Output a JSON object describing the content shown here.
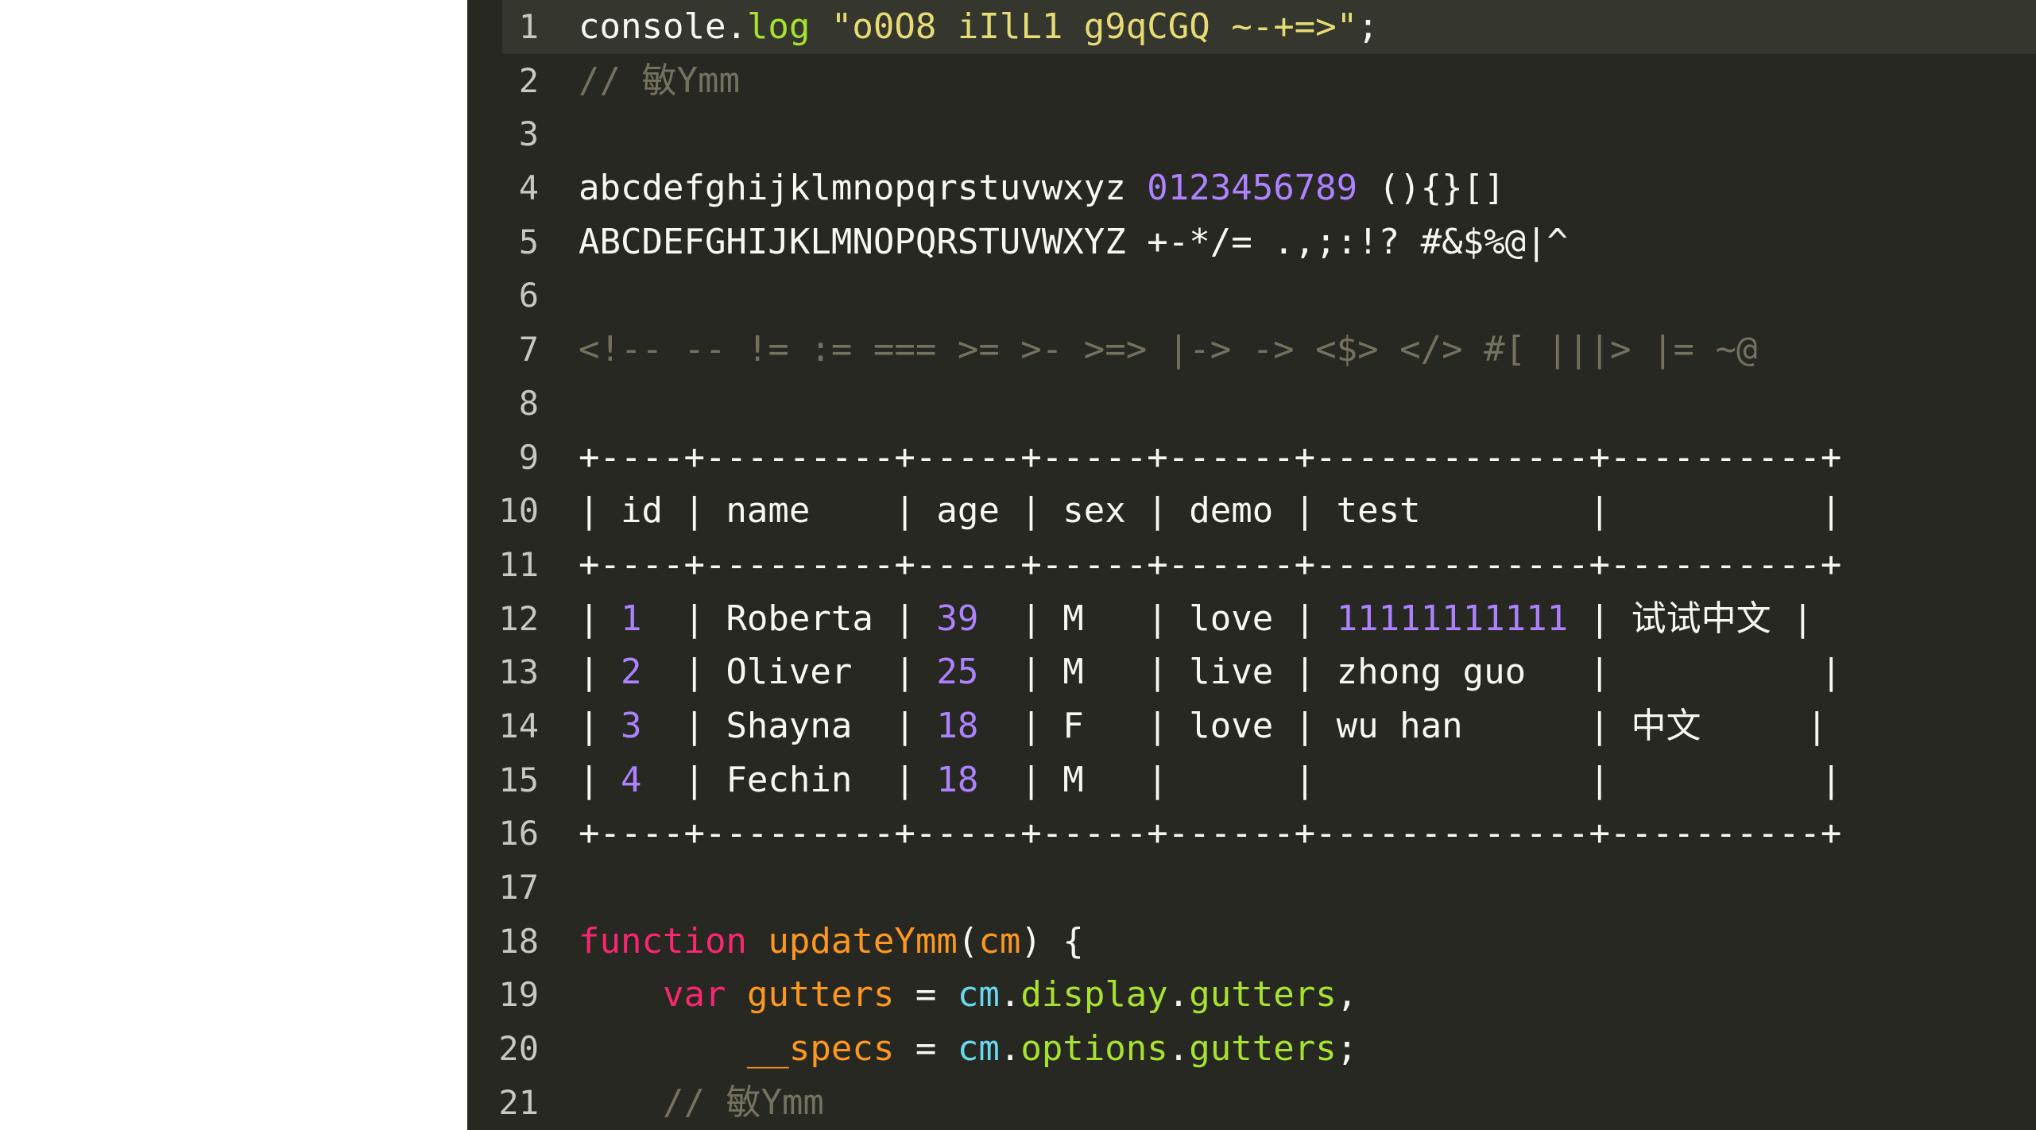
{
  "editor": {
    "theme_name": "monokai-dark",
    "colors": {
      "background": "#272822",
      "active_line_background": "#35372f",
      "gutter_text": "#c8c8c0",
      "foreground": "#f8f8f2",
      "comment": "#75715e",
      "string": "#e6db74",
      "number": "#ae81ff",
      "keyword": "#f92672",
      "function": "#fd971f",
      "variable": "#66d9ef",
      "property": "#a6e22e",
      "page_background": "#ffffff"
    },
    "active_line": 1,
    "lines": [
      {
        "number": "1",
        "active": true,
        "tokens": [
          {
            "text": "console",
            "type": "plain"
          },
          {
            "text": ".",
            "type": "punct"
          },
          {
            "text": "log",
            "type": "method"
          },
          {
            "text": " ",
            "type": "plain"
          },
          {
            "text": "\"o0O8 iIlL1 g9qCGQ ~-+=>\"",
            "type": "string"
          },
          {
            "text": ";",
            "type": "punct"
          }
        ]
      },
      {
        "number": "2",
        "active": false,
        "tokens": [
          {
            "text": "// ",
            "type": "comment"
          },
          {
            "text": "敏",
            "type": "comment-cjk"
          },
          {
            "text": "Ymm",
            "type": "comment"
          }
        ]
      },
      {
        "number": "3",
        "active": false,
        "tokens": []
      },
      {
        "number": "4",
        "active": false,
        "tokens": [
          {
            "text": "abcdefghijklmnopqrstuvwxyz ",
            "type": "plain"
          },
          {
            "text": "0123456789",
            "type": "number"
          },
          {
            "text": " (){}[]",
            "type": "plain"
          }
        ]
      },
      {
        "number": "5",
        "active": false,
        "tokens": [
          {
            "text": "ABCDEFGHIJKLMNOPQRSTUVWXYZ +-*/= .,;:!? #&$%@|^",
            "type": "plain"
          }
        ]
      },
      {
        "number": "6",
        "active": false,
        "tokens": []
      },
      {
        "number": "7",
        "active": false,
        "tokens": [
          {
            "text": "<!-- -- != := === >= >- >=> |-> -> <$> </> #[ |||> |= ~@",
            "type": "comment"
          }
        ]
      },
      {
        "number": "8",
        "active": false,
        "tokens": []
      },
      {
        "number": "9",
        "active": false,
        "tokens": [
          {
            "text": "+----+---------+-----+-----+------+-------------+----------+",
            "type": "plain"
          }
        ]
      },
      {
        "number": "10",
        "active": false,
        "tokens": [
          {
            "text": "| id | name    | age | sex | demo | test        |          |",
            "type": "plain"
          }
        ]
      },
      {
        "number": "11",
        "active": false,
        "tokens": [
          {
            "text": "+----+---------+-----+-----+------+-------------+----------+",
            "type": "plain"
          }
        ]
      },
      {
        "number": "12",
        "active": false,
        "tokens": [
          {
            "text": "| ",
            "type": "plain"
          },
          {
            "text": "1",
            "type": "number"
          },
          {
            "text": "  | Roberta | ",
            "type": "plain"
          },
          {
            "text": "39",
            "type": "number"
          },
          {
            "text": "  | M   | love | ",
            "type": "plain"
          },
          {
            "text": "11111111111",
            "type": "number"
          },
          {
            "text": " | ",
            "type": "plain"
          },
          {
            "text": "试试中文",
            "type": "cjk"
          },
          {
            "text": " |",
            "type": "plain"
          }
        ]
      },
      {
        "number": "13",
        "active": false,
        "tokens": [
          {
            "text": "| ",
            "type": "plain"
          },
          {
            "text": "2",
            "type": "number"
          },
          {
            "text": "  | Oliver  | ",
            "type": "plain"
          },
          {
            "text": "25",
            "type": "number"
          },
          {
            "text": "  | M   | live | zhong guo   |          |",
            "type": "plain"
          }
        ]
      },
      {
        "number": "14",
        "active": false,
        "tokens": [
          {
            "text": "| ",
            "type": "plain"
          },
          {
            "text": "3",
            "type": "number"
          },
          {
            "text": "  | Shayna  | ",
            "type": "plain"
          },
          {
            "text": "18",
            "type": "number"
          },
          {
            "text": "  | F   | love | wu han      | ",
            "type": "plain"
          },
          {
            "text": "中文",
            "type": "cjk"
          },
          {
            "text": "     |",
            "type": "plain"
          }
        ]
      },
      {
        "number": "15",
        "active": false,
        "tokens": [
          {
            "text": "| ",
            "type": "plain"
          },
          {
            "text": "4",
            "type": "number"
          },
          {
            "text": "  | Fechin  | ",
            "type": "plain"
          },
          {
            "text": "18",
            "type": "number"
          },
          {
            "text": "  | M   |      |             |          |",
            "type": "plain"
          }
        ]
      },
      {
        "number": "16",
        "active": false,
        "tokens": [
          {
            "text": "+----+---------+-----+-----+------+-------------+----------+",
            "type": "plain"
          }
        ]
      },
      {
        "number": "17",
        "active": false,
        "tokens": []
      },
      {
        "number": "18",
        "active": false,
        "tokens": [
          {
            "text": "function",
            "type": "keyword"
          },
          {
            "text": " ",
            "type": "plain"
          },
          {
            "text": "updateYmm",
            "type": "function"
          },
          {
            "text": "(",
            "type": "punct"
          },
          {
            "text": "cm",
            "type": "param"
          },
          {
            "text": ") {",
            "type": "punct"
          }
        ]
      },
      {
        "number": "19",
        "active": false,
        "tokens": [
          {
            "text": "    ",
            "type": "plain"
          },
          {
            "text": "var",
            "type": "keyword"
          },
          {
            "text": " ",
            "type": "plain"
          },
          {
            "text": "gutters",
            "type": "function"
          },
          {
            "text": " = ",
            "type": "punct"
          },
          {
            "text": "cm",
            "type": "variable"
          },
          {
            "text": ".",
            "type": "punct"
          },
          {
            "text": "display",
            "type": "property"
          },
          {
            "text": ".",
            "type": "punct"
          },
          {
            "text": "gutters",
            "type": "property"
          },
          {
            "text": ",",
            "type": "punct"
          }
        ]
      },
      {
        "number": "20",
        "active": false,
        "tokens": [
          {
            "text": "        ",
            "type": "plain"
          },
          {
            "text": "__specs",
            "type": "function"
          },
          {
            "text": " = ",
            "type": "punct"
          },
          {
            "text": "cm",
            "type": "variable"
          },
          {
            "text": ".",
            "type": "punct"
          },
          {
            "text": "options",
            "type": "property"
          },
          {
            "text": ".",
            "type": "punct"
          },
          {
            "text": "gutters",
            "type": "property"
          },
          {
            "text": ";",
            "type": "punct"
          }
        ]
      },
      {
        "number": "21",
        "active": false,
        "tokens": [
          {
            "text": "    ",
            "type": "plain"
          },
          {
            "text": "// ",
            "type": "comment"
          },
          {
            "text": "敏",
            "type": "comment-cjk"
          },
          {
            "text": "Ymm",
            "type": "comment"
          }
        ]
      }
    ],
    "table_preview": {
      "columns": [
        "id",
        "name",
        "age",
        "sex",
        "demo",
        "test",
        ""
      ],
      "rows": [
        [
          "1",
          "Roberta",
          "39",
          "M",
          "love",
          "11111111111",
          "试试中文"
        ],
        [
          "2",
          "Oliver",
          "25",
          "M",
          "live",
          "zhong guo",
          ""
        ],
        [
          "3",
          "Shayna",
          "18",
          "F",
          "love",
          "wu han",
          "中文"
        ],
        [
          "4",
          "Fechin",
          "18",
          "M",
          "",
          "",
          ""
        ]
      ]
    }
  }
}
